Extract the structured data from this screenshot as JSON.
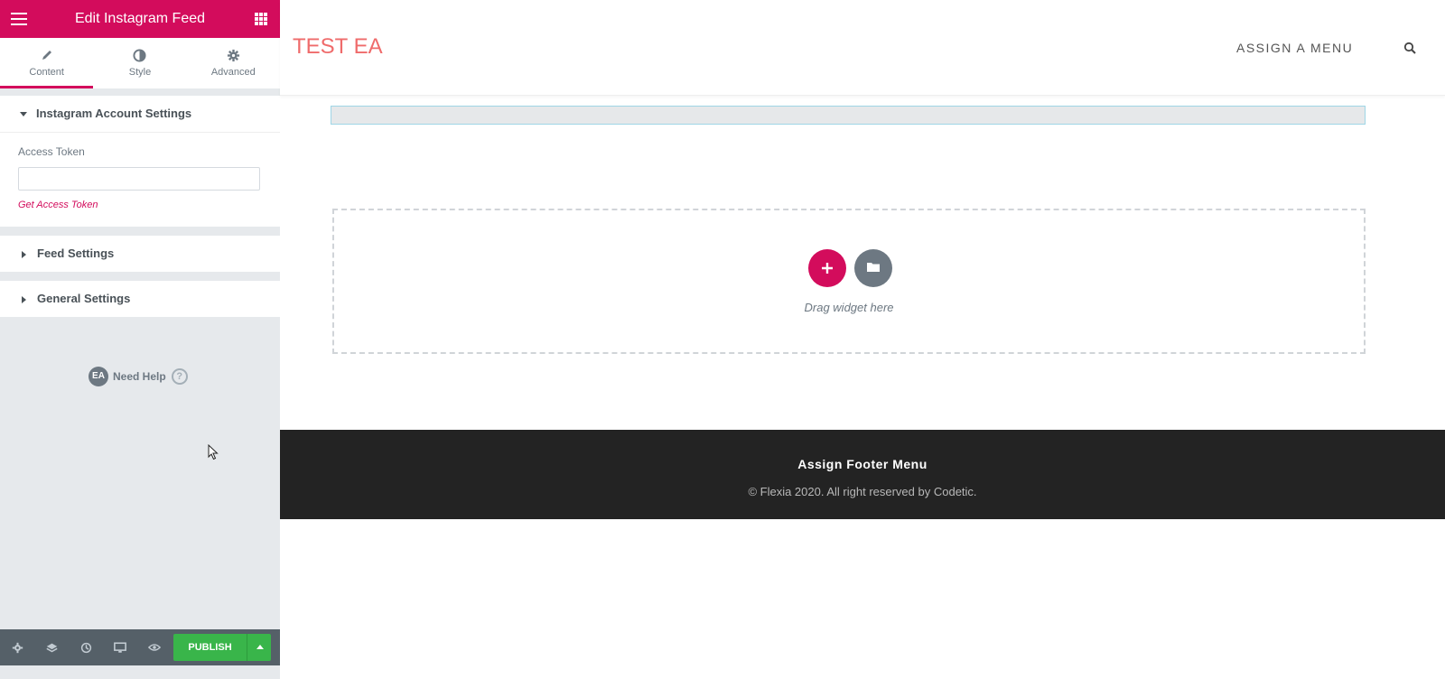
{
  "panel": {
    "header_title": "Edit Instagram Feed",
    "tabs": [
      {
        "label": "Content",
        "icon": "pencil-icon"
      },
      {
        "label": "Style",
        "icon": "half-circle-icon"
      },
      {
        "label": "Advanced",
        "icon": "gear-icon"
      }
    ],
    "sections": {
      "account": {
        "title": "Instagram Account Settings",
        "access_token_label": "Access Token",
        "access_token_value": "",
        "get_token_link": "Get Access Token"
      },
      "feed": {
        "title": "Feed Settings"
      },
      "general": {
        "title": "General Settings"
      }
    },
    "need_help": {
      "badge": "EA",
      "label": "Need Help",
      "icon": "?"
    },
    "footer": {
      "publish_label": "PUBLISH",
      "icons": [
        "settings-icon",
        "layers-icon",
        "history-icon",
        "responsive-icon",
        "preview-icon"
      ]
    },
    "accent_color": "#d30c5c",
    "publish_color": "#39b54a"
  },
  "site": {
    "logo": "TEST EA",
    "menu": "ASSIGN A MENU",
    "logo_color": "#ef6b6b"
  },
  "canvas": {
    "drag_text": "Drag widget here"
  },
  "site_footer": {
    "menu": "Assign Footer Menu",
    "copyright": "© Flexia 2020. All right reserved by Codetic."
  }
}
